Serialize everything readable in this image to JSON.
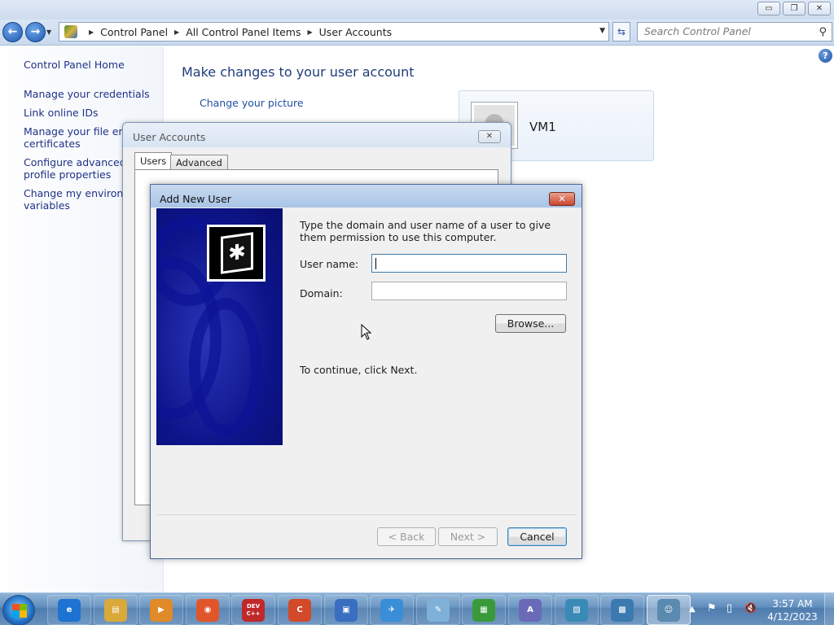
{
  "window": {
    "minimize_glyph": "▭",
    "restore_glyph": "❐",
    "close_glyph": "✕"
  },
  "address": {
    "crumbs": [
      "Control Panel",
      "All Control Panel Items",
      "User Accounts"
    ],
    "separator": "▶",
    "dropdown": "▼"
  },
  "search": {
    "placeholder": "Search Control Panel"
  },
  "left_pane": {
    "items": [
      "Control Panel Home",
      "Manage your credentials",
      "Link online IDs",
      "Manage your file encry",
      "certificates",
      "Configure advanced us",
      "profile properties",
      "Change my environme",
      "variables"
    ]
  },
  "main": {
    "title": "Make changes to your user account",
    "link_change_picture": "Change your picture",
    "user_name": "VM1",
    "help": "?"
  },
  "user_accounts_dialog": {
    "title": "User Accounts",
    "close": "✕",
    "tabs": [
      "Users",
      "Advanced"
    ]
  },
  "add_user_dialog": {
    "title": "Add New User",
    "close": "✕",
    "instruction": "Type the domain and user name of a user to give them permission to use this computer.",
    "user_name_label": "User name:",
    "user_name_value": "",
    "domain_label": "Domain:",
    "domain_value": "",
    "browse": "Browse...",
    "continue_text": "To continue, click Next.",
    "back": "< Back",
    "next": "Next >",
    "cancel": "Cancel",
    "badge_glyph": "✱"
  },
  "taskbar": {
    "icons": [
      {
        "name": "internet-explorer-icon",
        "glyph": "e",
        "color": "#1e73d2"
      },
      {
        "name": "file-explorer-icon",
        "glyph": "▤",
        "color": "#d9a93a"
      },
      {
        "name": "media-player-icon",
        "glyph": "▶",
        "color": "#e08a2a"
      },
      {
        "name": "browser-icon",
        "glyph": "◉",
        "color": "#e0562a"
      },
      {
        "name": "dev-cpp-icon",
        "glyph": "DEV C++",
        "color": "#c0282a"
      },
      {
        "name": "ccleaner-icon",
        "glyph": "C",
        "color": "#d24a2a"
      },
      {
        "name": "remote-desktop-icon",
        "glyph": "▣",
        "color": "#3a6ec0"
      },
      {
        "name": "paper-plane-icon",
        "glyph": "✈",
        "color": "#3a8ed8"
      },
      {
        "name": "notepad-icon",
        "glyph": "✎",
        "color": "#7fb0d8"
      },
      {
        "name": "avg-icon",
        "glyph": "▦",
        "color": "#3a9a3a"
      },
      {
        "name": "vector-app-icon",
        "glyph": "A",
        "color": "#6a6ab8"
      },
      {
        "name": "image-viewer-icon",
        "glyph": "▧",
        "color": "#3a8ab8"
      },
      {
        "name": "control-panel-icon",
        "glyph": "▩",
        "color": "#3a7ab0"
      },
      {
        "name": "user-accounts-icon",
        "glyph": "☺",
        "color": "#5a8ab0"
      }
    ],
    "tray_arrow": "▲",
    "tray_flag": "⚑",
    "tray_network": "▯",
    "tray_volume": "🔇",
    "time": "3:57 AM",
    "date": "4/12/2023"
  }
}
